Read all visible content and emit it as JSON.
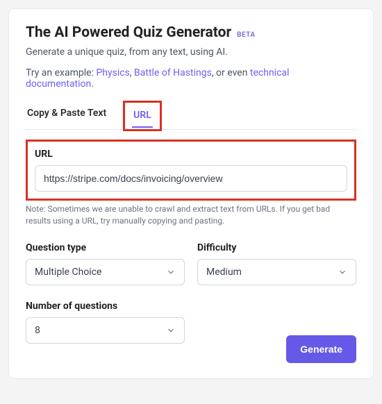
{
  "header": {
    "title": "The AI Powered Quiz Generator",
    "beta_label": "BETA",
    "subtitle": "Generate a unique quiz, from any text, using AI.",
    "example_prefix": "Try an example: ",
    "example_link_1": "Physics",
    "example_sep_1": ", ",
    "example_link_2": "Battle of Hastings",
    "example_mid": ", or even ",
    "example_link_3": "technical documentation",
    "example_suffix": "."
  },
  "tabs": {
    "copy_paste": "Copy & Paste Text",
    "url": "URL",
    "active": "url"
  },
  "url_section": {
    "label": "URL",
    "value": "https://stripe.com/docs/invoicing/overview",
    "note": "Note: Sometimes we are unable to crawl and extract text from URLs. If you get bad results using a URL, try manually copying and pasting."
  },
  "question_type": {
    "label": "Question type",
    "selected": "Multiple Choice"
  },
  "difficulty": {
    "label": "Difficulty",
    "selected": "Medium"
  },
  "num_questions": {
    "label": "Number of questions",
    "selected": "8"
  },
  "footer": {
    "generate_label": "Generate"
  }
}
